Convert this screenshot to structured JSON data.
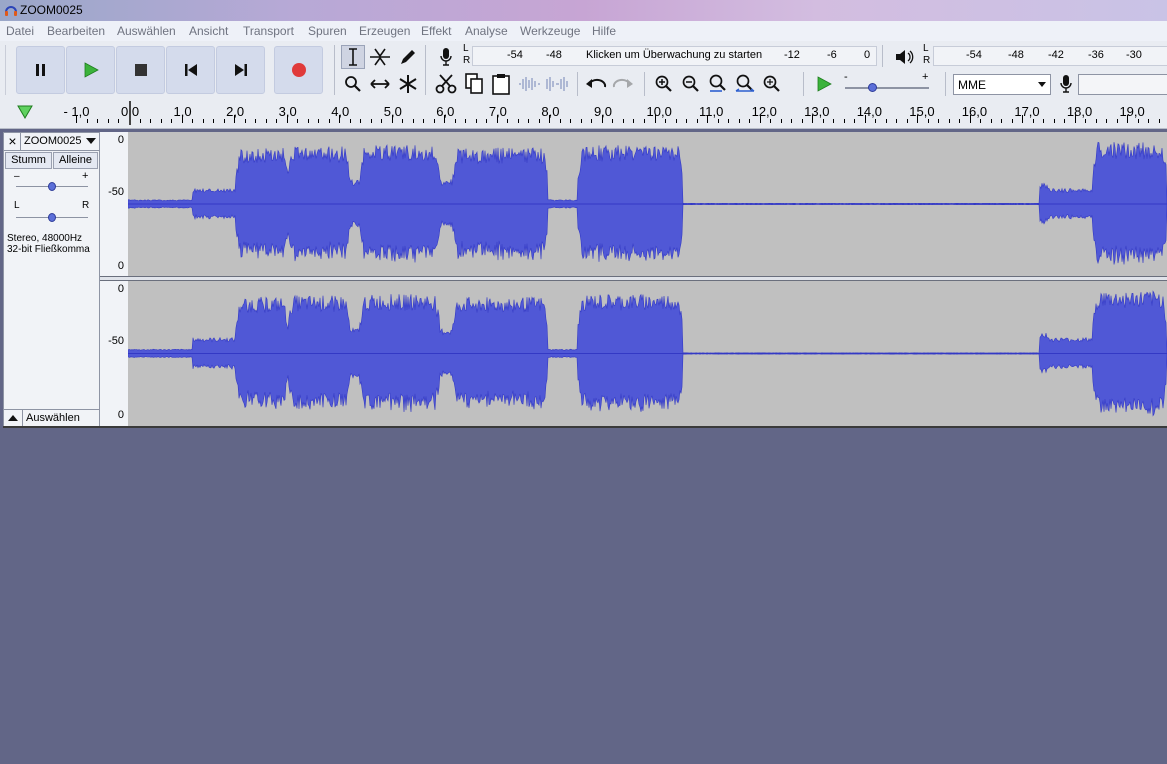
{
  "window": {
    "title": "ZOOM0025"
  },
  "menu": [
    "Datei",
    "Bearbeiten",
    "Auswählen",
    "Ansicht",
    "Transport",
    "Spuren",
    "Erzeugen",
    "Effekt",
    "Analyse",
    "Werkzeuge",
    "Hilfe"
  ],
  "transport": [
    "pause-icon",
    "play-icon",
    "stop-icon",
    "skip-start-icon",
    "skip-end-icon",
    "record-icon"
  ],
  "colors": {
    "wave": "#5058d6",
    "wave_edge": "#3339c5",
    "record": "#e03a3a",
    "play": "#3bb33b"
  },
  "record_meter": {
    "lr_top": "L",
    "lr_bottom": "R",
    "ticks": [
      "-54",
      "-48",
      "-12",
      "-6",
      "0"
    ],
    "hint": "Klicken um Überwachung zu starten"
  },
  "playback_meter": {
    "lr_top": "L",
    "lr_bottom": "R",
    "ticks": [
      "-54",
      "-48",
      "-42",
      "-36",
      "-30"
    ]
  },
  "speed_slider": {
    "minus": "-",
    "plus": "+"
  },
  "host_select": {
    "value": "MME"
  },
  "ruler": {
    "labels": [
      "- 1,0",
      "0,0",
      "1,0",
      "2,0",
      "3,0",
      "4,0",
      "5,0",
      "6,0",
      "7,0",
      "8,0",
      "9,0",
      "10,0",
      "11,0",
      "12,0",
      "13,0",
      "14,0",
      "15,0",
      "16,0",
      "17,0",
      "18,0",
      "19,0"
    ]
  },
  "track": {
    "close": "×",
    "name": "ZOOM0025",
    "mute": "Stumm",
    "solo": "Alleine",
    "gain_minus": "–",
    "gain_plus": "+",
    "pan_left": "L",
    "pan_right": "R",
    "format_line1": "Stereo, 48000Hz",
    "format_line2": "32-bit Fließkomma",
    "select": "Auswählen",
    "scale_top": "0",
    "scale_mid": "-50",
    "scale_bottom": "0"
  }
}
